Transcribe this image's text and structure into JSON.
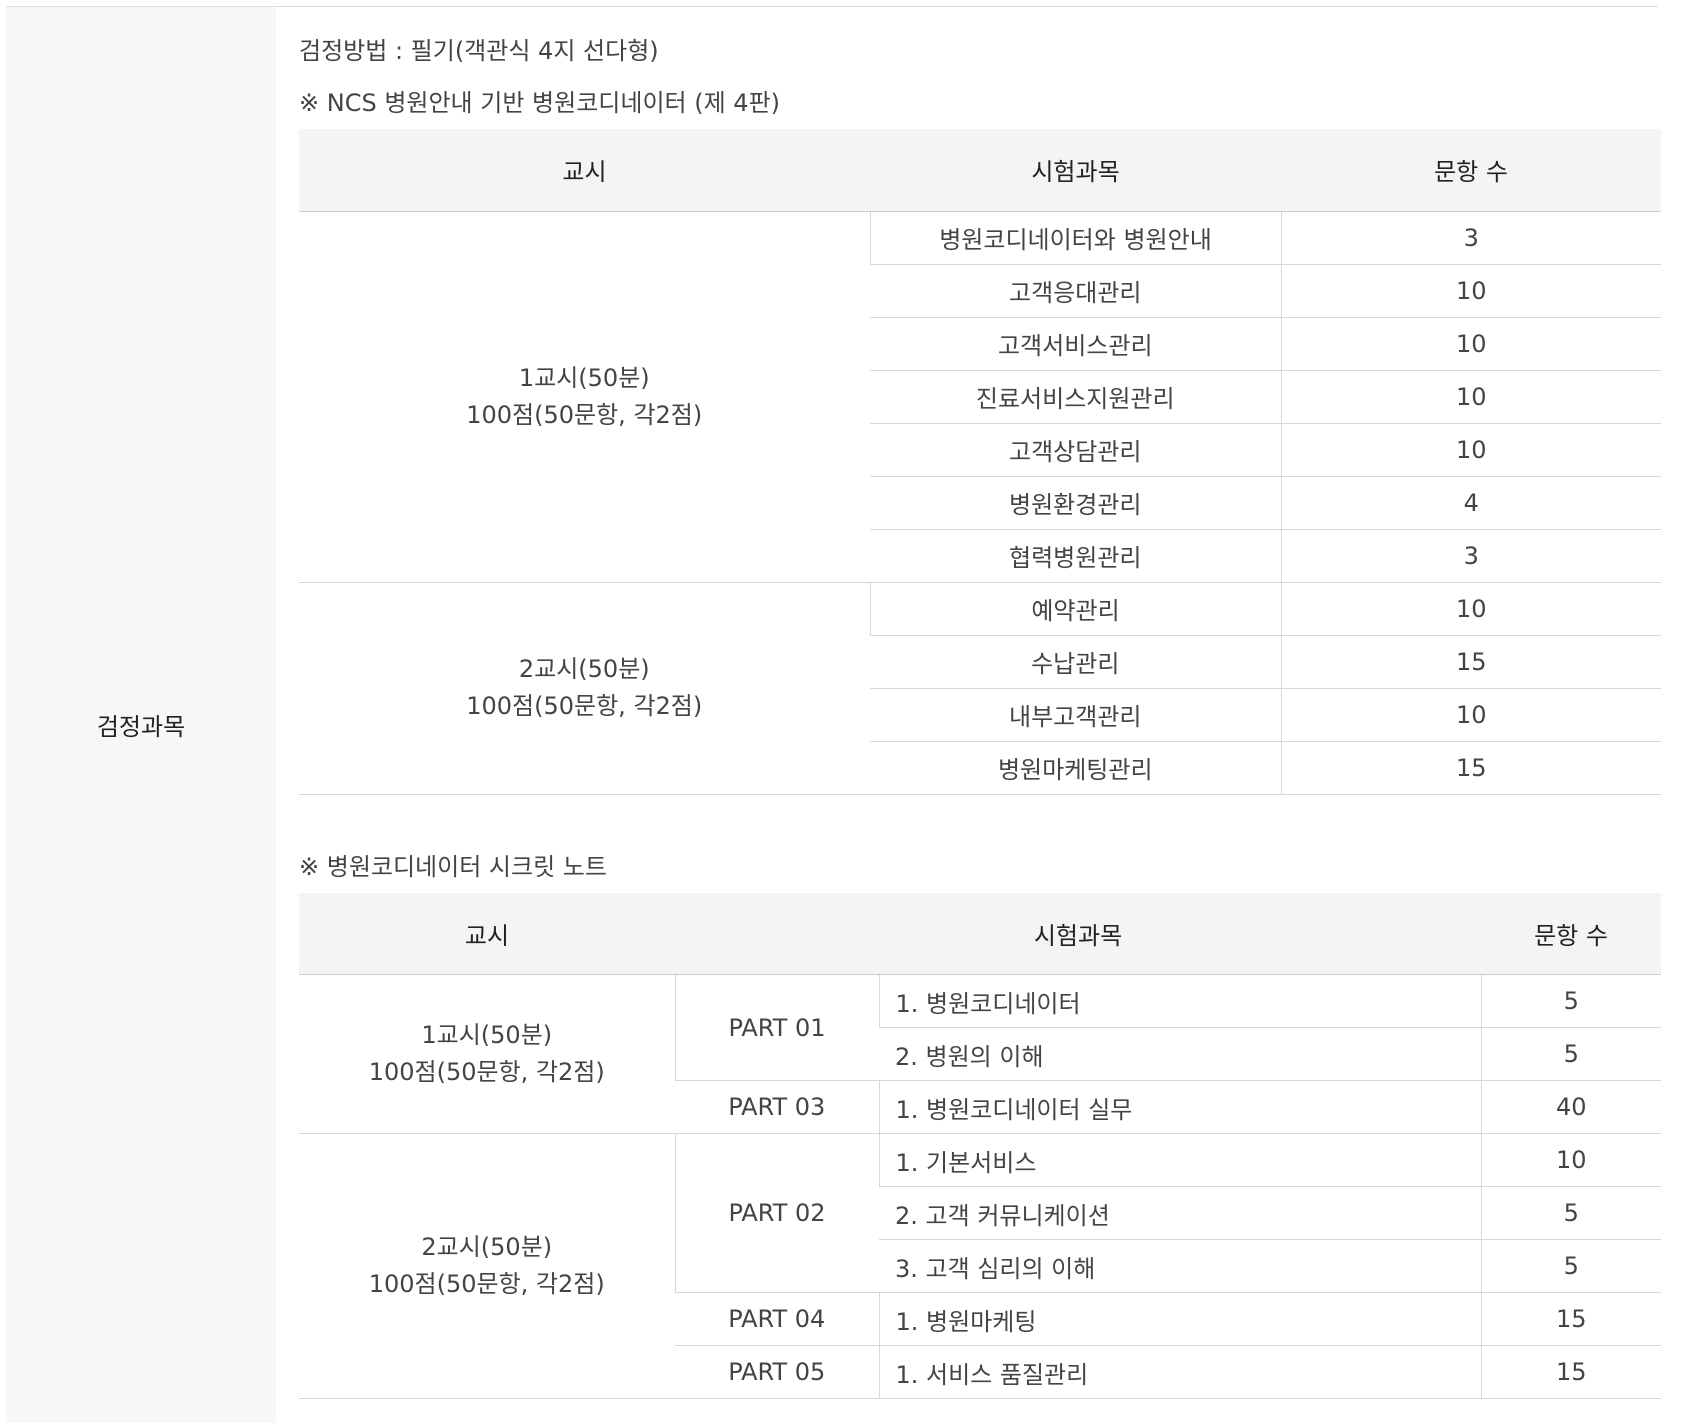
{
  "side_label": "검정과목",
  "method_line": "검정방법 : 필기(객관식 4지 선다형)",
  "table1": {
    "note": "※ NCS 병원안내 기반 병원코디네이터 (제 4판)",
    "headers": [
      "교시",
      "시험과목",
      "문항 수"
    ],
    "groups": [
      {
        "period": "1교시(50분)",
        "score": "100점(50문항, 각2점)",
        "rows": [
          {
            "subject": "병원코디네이터와 병원안내",
            "count": "3"
          },
          {
            "subject": "고객응대관리",
            "count": "10"
          },
          {
            "subject": "고객서비스관리",
            "count": "10"
          },
          {
            "subject": "진료서비스지원관리",
            "count": "10"
          },
          {
            "subject": "고객상담관리",
            "count": "10"
          },
          {
            "subject": "병원환경관리",
            "count": "4"
          },
          {
            "subject": "협력병원관리",
            "count": "3"
          }
        ]
      },
      {
        "period": "2교시(50분)",
        "score": "100점(50문항, 각2점)",
        "rows": [
          {
            "subject": "예약관리",
            "count": "10"
          },
          {
            "subject": "수납관리",
            "count": "15"
          },
          {
            "subject": "내부고객관리",
            "count": "10"
          },
          {
            "subject": "병원마케팅관리",
            "count": "15"
          }
        ]
      }
    ]
  },
  "table2": {
    "note": "※ 병원코디네이터 시크릿 노트",
    "headers": [
      "교시",
      "시험과목",
      "문항 수"
    ],
    "groups": [
      {
        "period": "1교시(50분)",
        "score": "100점(50문항, 각2점)",
        "parts": [
          {
            "part": "PART 01",
            "rows": [
              {
                "subject": "1. 병원코디네이터",
                "count": "5"
              },
              {
                "subject": "2. 병원의 이해",
                "count": "5"
              }
            ]
          },
          {
            "part": "PART 03",
            "rows": [
              {
                "subject": "1. 병원코디네이터 실무",
                "count": "40"
              }
            ]
          }
        ]
      },
      {
        "period": "2교시(50분)",
        "score": "100점(50문항, 각2점)",
        "parts": [
          {
            "part": "PART 02",
            "rows": [
              {
                "subject": "1. 기본서비스",
                "count": "10"
              },
              {
                "subject": "2. 고객 커뮤니케이션",
                "count": "5"
              },
              {
                "subject": "3. 고객 심리의 이해",
                "count": "5"
              }
            ]
          },
          {
            "part": "PART 04",
            "rows": [
              {
                "subject": "1. 병원마케팅",
                "count": "15"
              }
            ]
          },
          {
            "part": "PART 05",
            "rows": [
              {
                "subject": "1. 서비스 품질관리",
                "count": "15"
              }
            ]
          }
        ]
      }
    ]
  }
}
